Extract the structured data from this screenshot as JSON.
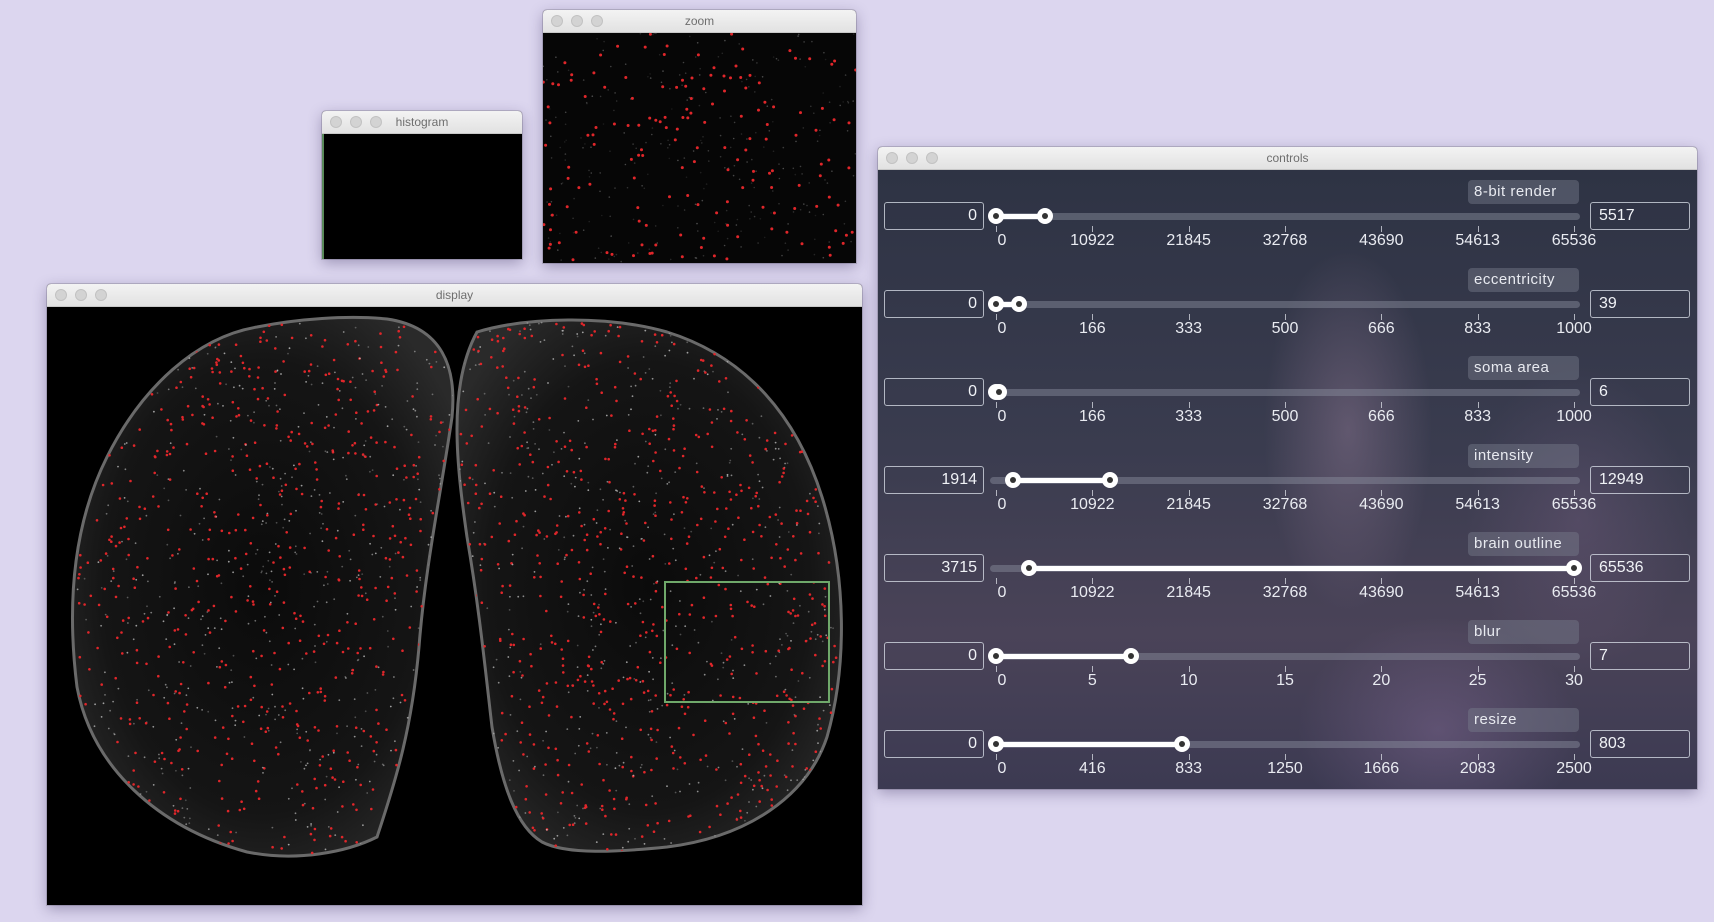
{
  "windows": {
    "histogram": {
      "title": "histogram"
    },
    "zoom": {
      "title": "zoom"
    },
    "display": {
      "title": "display"
    },
    "controls": {
      "title": "controls"
    }
  },
  "controls": [
    {
      "label": "8-bit render",
      "min_value": "0",
      "max_value": "5517",
      "range": [
        0,
        65536
      ],
      "low": 0,
      "high": 5517,
      "ticks": [
        "0",
        "10922",
        "21845",
        "32768",
        "43690",
        "54613",
        "65536"
      ]
    },
    {
      "label": "eccentricity",
      "min_value": "0",
      "max_value": "39",
      "range": [
        0,
        1000
      ],
      "low": 0,
      "high": 39,
      "ticks": [
        "0",
        "166",
        "333",
        "500",
        "666",
        "833",
        "1000"
      ]
    },
    {
      "label": "soma area",
      "min_value": "0",
      "max_value": "6",
      "range": [
        0,
        1000
      ],
      "low": 0,
      "high": 6,
      "ticks": [
        "0",
        "166",
        "333",
        "500",
        "666",
        "833",
        "1000"
      ]
    },
    {
      "label": "intensity",
      "min_value": "1914",
      "max_value": "12949",
      "range": [
        0,
        65536
      ],
      "low": 1914,
      "high": 12949,
      "ticks": [
        "0",
        "10922",
        "21845",
        "32768",
        "43690",
        "54613",
        "65536"
      ]
    },
    {
      "label": "brain outline",
      "min_value": "3715",
      "max_value": "65536",
      "range": [
        0,
        65536
      ],
      "low": 3715,
      "high": 65536,
      "ticks": [
        "0",
        "10922",
        "21845",
        "32768",
        "43690",
        "54613",
        "65536"
      ]
    },
    {
      "label": "blur",
      "min_value": "0",
      "max_value": "7",
      "range": [
        0,
        30
      ],
      "low": 0,
      "high": 7,
      "ticks": [
        "0",
        "5",
        "10",
        "15",
        "20",
        "25",
        "30"
      ]
    },
    {
      "label": "resize",
      "min_value": "0",
      "max_value": "803",
      "range": [
        0,
        2500
      ],
      "low": 0,
      "high": 803,
      "ticks": [
        "0",
        "416",
        "833",
        "1250",
        "1666",
        "2083",
        "2500"
      ]
    }
  ],
  "colors": {
    "desktop": "#dcd6ef",
    "cell_marker": "#e0262a",
    "roi_box": "#6fa86a"
  }
}
